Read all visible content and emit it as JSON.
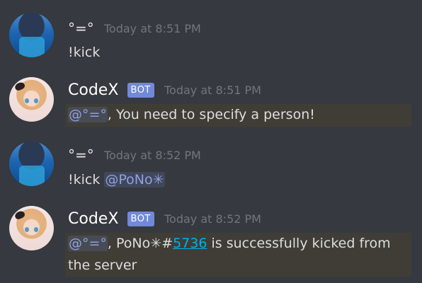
{
  "messages": [
    {
      "author": "°=°",
      "timestamp": "Today at 8:51 PM",
      "text": "!kick"
    },
    {
      "author": "CodeX",
      "badge": "BOT",
      "timestamp": "Today at 8:51 PM",
      "mention": "@°=°",
      "text": ", You need to specify a person!"
    },
    {
      "author": "°=°",
      "timestamp": "Today at 8:52 PM",
      "text": "!kick ",
      "mention": "@PoNo✳"
    },
    {
      "author": "CodeX",
      "badge": "BOT",
      "timestamp": "Today at 8:52 PM",
      "mention": "@°=°",
      "text_before": ", PoNo✳#",
      "link": "5736",
      "text_after": " is successfully kicked from the server"
    }
  ],
  "colors": {
    "background": "#36393f",
    "bot_badge": "#7289da",
    "mention": "#8ea1e1",
    "highlight": "#3f3d36"
  }
}
